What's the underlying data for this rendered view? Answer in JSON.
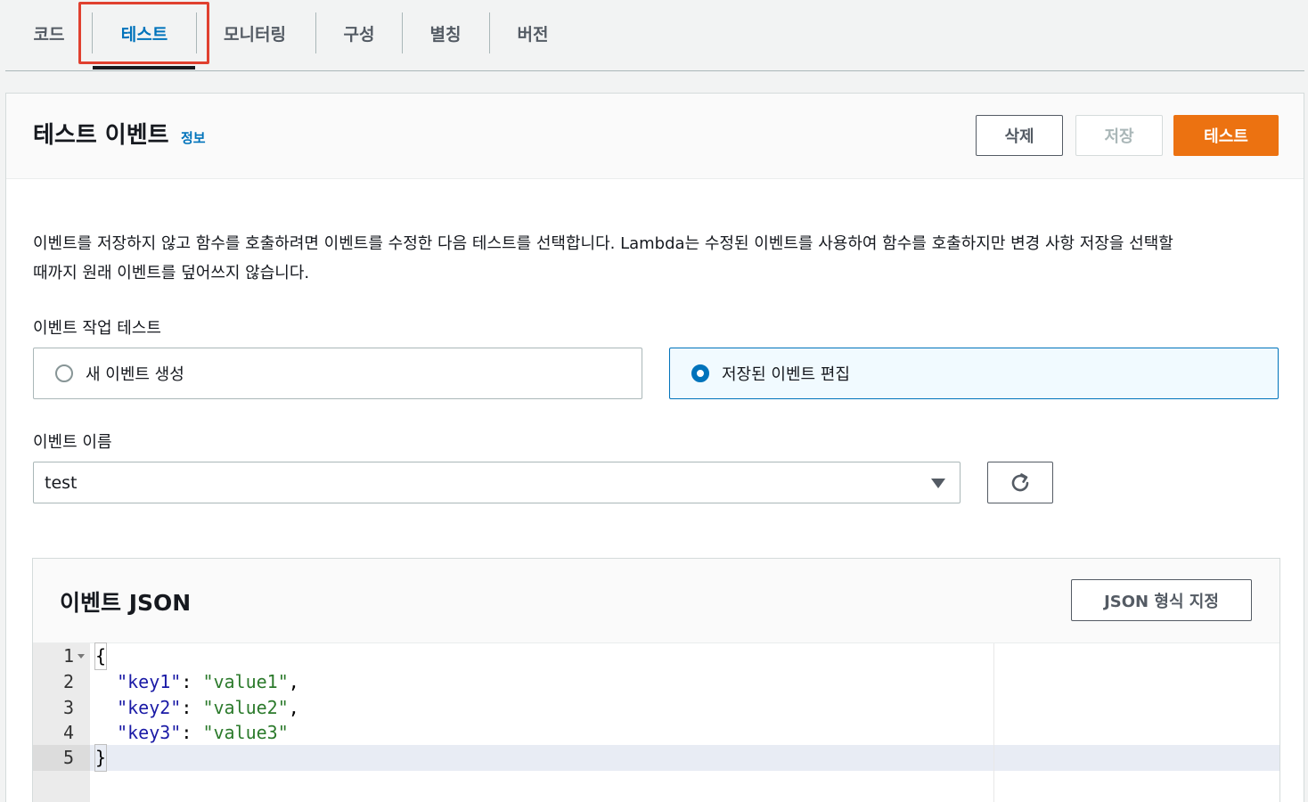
{
  "tabs": [
    {
      "label": "코드"
    },
    {
      "label": "테스트"
    },
    {
      "label": "모니터링"
    },
    {
      "label": "구성"
    },
    {
      "label": "별칭"
    },
    {
      "label": "버전"
    }
  ],
  "panel": {
    "title": "테스트 이벤트",
    "info": "정보",
    "buttons": {
      "delete": "삭제",
      "save": "저장",
      "test": "테스트"
    },
    "description_line1": "이벤트를 저장하지 않고 함수를 호출하려면 이벤트를 수정한 다음 테스트를 선택합니다. Lambda는 수정된 이벤트를 사용하여 함수를 호출하지만 변경 사항 저장을 선택할",
    "description_line2": "때까지 원래 이벤트를 덮어쓰지 않습니다.",
    "action_label": "이벤트 작업 테스트",
    "radio_new": "새 이벤트 생성",
    "radio_edit": "저장된 이벤트 편집",
    "event_name_label": "이벤트 이름",
    "event_name_value": "test"
  },
  "json_panel": {
    "title": "이벤트 JSON",
    "format_button": "JSON 형식 지정",
    "lines": [
      {
        "n": "1",
        "key": "",
        "value": "",
        "text": "{"
      },
      {
        "n": "2",
        "key": "\"key1\"",
        "value": "\"value1\"",
        "suffix": ","
      },
      {
        "n": "3",
        "key": "\"key2\"",
        "value": "\"value2\"",
        "suffix": ","
      },
      {
        "n": "4",
        "key": "\"key3\"",
        "value": "\"value3\"",
        "suffix": ""
      },
      {
        "n": "5",
        "key": "",
        "value": "",
        "text": "}"
      }
    ]
  },
  "colors": {
    "accent": "#0073bb",
    "primary_button": "#ec7211",
    "highlight_box": "#e0402f"
  },
  "icons": {
    "refresh": "refresh-icon",
    "dropdown": "caret-down-icon"
  }
}
